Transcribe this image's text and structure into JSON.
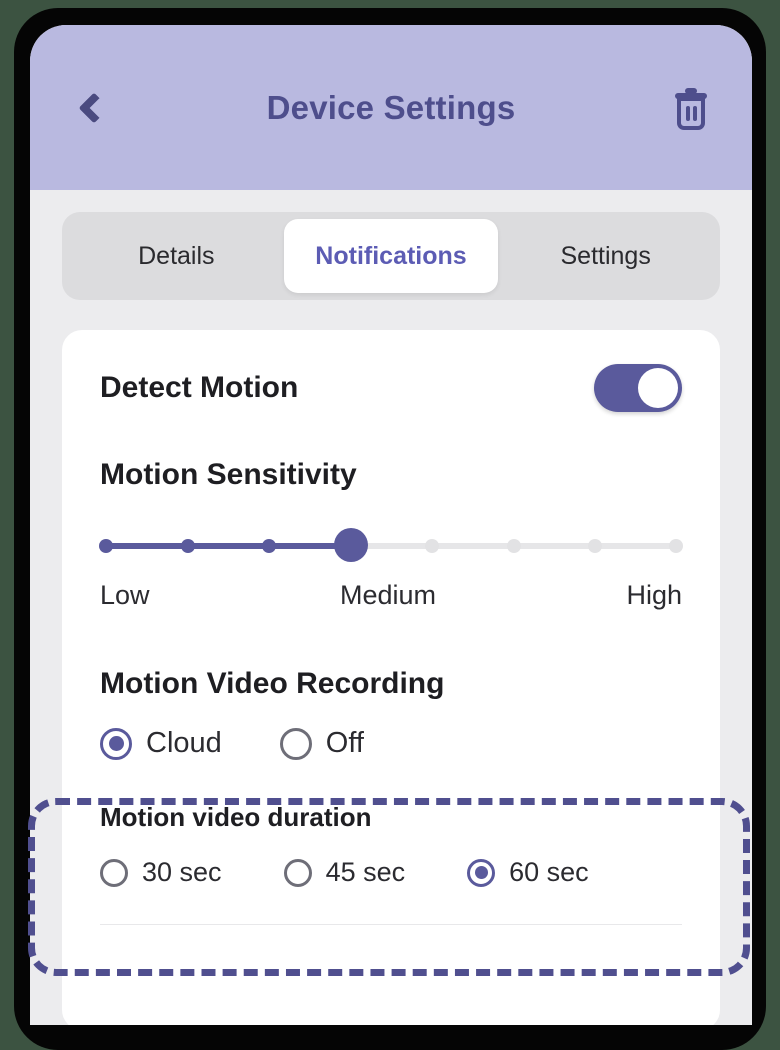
{
  "header": {
    "title": "Device Settings",
    "back_icon": "chevron-left-icon",
    "delete_icon": "trash-icon"
  },
  "tabs": [
    {
      "label": "Details",
      "active": false
    },
    {
      "label": "Notifications",
      "active": true
    },
    {
      "label": "Settings",
      "active": false
    }
  ],
  "detect_motion": {
    "label": "Detect Motion",
    "toggle_state": "on"
  },
  "motion_sensitivity": {
    "title": "Motion Sensitivity",
    "value_index": 3,
    "steps": 8,
    "labels": {
      "low": "Low",
      "medium": "Medium",
      "high": "High"
    }
  },
  "motion_video_recording": {
    "title": "Motion Video Recording",
    "options": [
      {
        "label": "Cloud",
        "selected": true
      },
      {
        "label": "Off",
        "selected": false
      }
    ]
  },
  "motion_video_duration": {
    "title": "Motion video duration",
    "options": [
      {
        "label": "30 sec",
        "selected": false
      },
      {
        "label": "45 sec",
        "selected": false
      },
      {
        "label": "60 sec",
        "selected": true
      }
    ]
  },
  "colors": {
    "accent": "#5a5a9c",
    "header_bg": "#b9b9e0",
    "header_text": "#4e4e8c",
    "tab_active_text": "#5c5cb4",
    "app_bg": "#ececee",
    "annotation": "#504f8f"
  }
}
